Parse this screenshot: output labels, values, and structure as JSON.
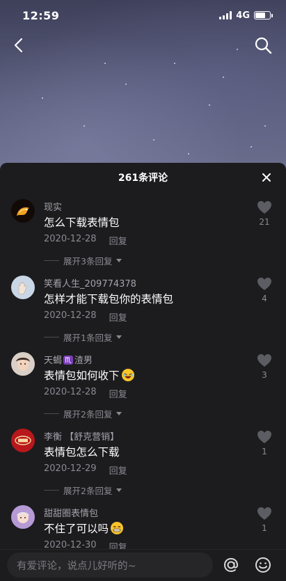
{
  "status_bar": {
    "time": "12:59",
    "network": "4G",
    "battery_level": 0.7
  },
  "comments_sheet": {
    "title": "261条评论"
  },
  "comments": [
    {
      "username": "现实",
      "text": "怎么下载表情包",
      "date": "2020-12-28",
      "reply_label": "回复",
      "likes": "21",
      "expand_label": "展开3条回复",
      "avatar": "lion-avatar"
    },
    {
      "username": "笑看人生_209774378",
      "text": "怎样才能下载包你的表情包",
      "date": "2020-12-28",
      "reply_label": "回复",
      "likes": "4",
      "expand_label": "展开1条回复",
      "avatar": "hand-avatar"
    },
    {
      "username_prefix": "天蝎",
      "username_badge": "♏",
      "username_suffix": "渣男",
      "text": "表情包如何收下",
      "text_emoji": "laughing-emoji",
      "date": "2020-12-28",
      "reply_label": "回复",
      "likes": "3",
      "expand_label": "展开2条回复",
      "avatar": "portrait-avatar"
    },
    {
      "username": "李衡 【舒克营销】",
      "text": "表情包怎么下载",
      "date": "2020-12-29",
      "reply_label": "回复",
      "likes": "1",
      "expand_label": "展开2条回复",
      "avatar": "red-logo-avatar"
    },
    {
      "username": "甜甜圈表情包",
      "text": "不住了可以吗",
      "text_emoji": "grinning-emoji",
      "date": "2020-12-30",
      "reply_label": "回复",
      "likes": "1",
      "avatar": "girl-avatar"
    }
  ],
  "input_bar": {
    "placeholder": "有爱评论，说点儿好听的~"
  },
  "colors": {
    "sheet_bg": "#1c1c1f",
    "muted_text": "#8a8a92",
    "username_text": "#a3a3ab"
  }
}
